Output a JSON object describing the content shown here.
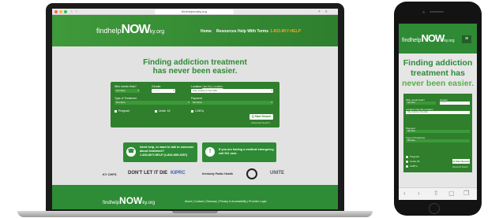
{
  "laptop": {
    "browser": {
      "url": "findhelpnowky.org",
      "close_icon": "x",
      "plus_icon": "+"
    },
    "header": {
      "logo": {
        "prefix": "findhelp",
        "now": "NOW",
        "suffix": "ky.org"
      },
      "nav": [
        "Home",
        "Resources",
        "Help With Terms",
        "1-833-8KY-HELP"
      ]
    },
    "hero": {
      "title_line1": "Finding addiction treatment",
      "title_line2": "has never been easier."
    },
    "form": {
      "who_label": "Who needs Help?",
      "who_value": "Not Sure",
      "gender_label": "Gender",
      "gender_value": "———",
      "location_label": "Location",
      "location_link": "Use My Location",
      "location_placeholder": "City, county or zip code",
      "type_label": "Type of Treatment",
      "type_value": "Not Sure",
      "payment_label": "Payment",
      "payment_value": "Not Sure",
      "checkbox_pregnant": "Pregnant",
      "checkbox_under18": "Under 18",
      "checkbox_lgbtq": "LGBTq",
      "search_button": "Q Start Search",
      "advanced_search": "Advanced Search"
    },
    "help_boxes": [
      {
        "icon": "phone-icon",
        "glyph": "☎",
        "text": "Need help, or want to talk to someone\nabout treatment?\n1-833-8KY-HELP (1-833-859-4357)"
      },
      {
        "icon": "alert-icon",
        "glyph": "!",
        "text": "If you are having a medical emergency,\ncall 911 now."
      }
    ],
    "partners": [
      "KY CHFS",
      "DON'T LET IT DIE",
      "KIPRC",
      "Kentucky Public Health",
      "Seal",
      "UNITE"
    ],
    "footer": {
      "logo": {
        "prefix": "findhelp",
        "now": "NOW",
        "suffix": "ky.org"
      },
      "links": "About  |  Contact  |  Glossary  |  Privacy & Accessibility  |  Provider Login"
    }
  },
  "phone": {
    "header": {
      "logo": {
        "prefix": "findhelp",
        "now": "NOW",
        "suffix": "ky.org"
      },
      "menu_icon": "≡"
    },
    "title_lines": [
      "Finding addiction",
      "treatment has",
      "never been easier."
    ],
    "form": {
      "who_label": "Who needs Help?",
      "who_value": "Not Sure",
      "gender_label": "Gender",
      "gender_value": "———",
      "location_label": "Location",
      "location_link": "Use My Location",
      "location_placeholder": "City, county or zip code",
      "payment_label": "Payment",
      "payment_value": "Not Sure",
      "type_label": "Type of Treatment",
      "type_value": "Not Sure",
      "checkbox_pregnant": "Pregnant",
      "checkbox_under18": "Under 18",
      "checkbox_lgbtq": "LGBTq",
      "search_button": "Q Start Search",
      "advanced_search": "Advanced Search"
    },
    "toolbar": [
      "‹",
      "›",
      "⇧",
      "▢",
      "❐"
    ]
  },
  "colors": {
    "brand_green": "#2e8b36",
    "header_green": "#3f9a3b",
    "nav_highlight": "#f6a623"
  }
}
